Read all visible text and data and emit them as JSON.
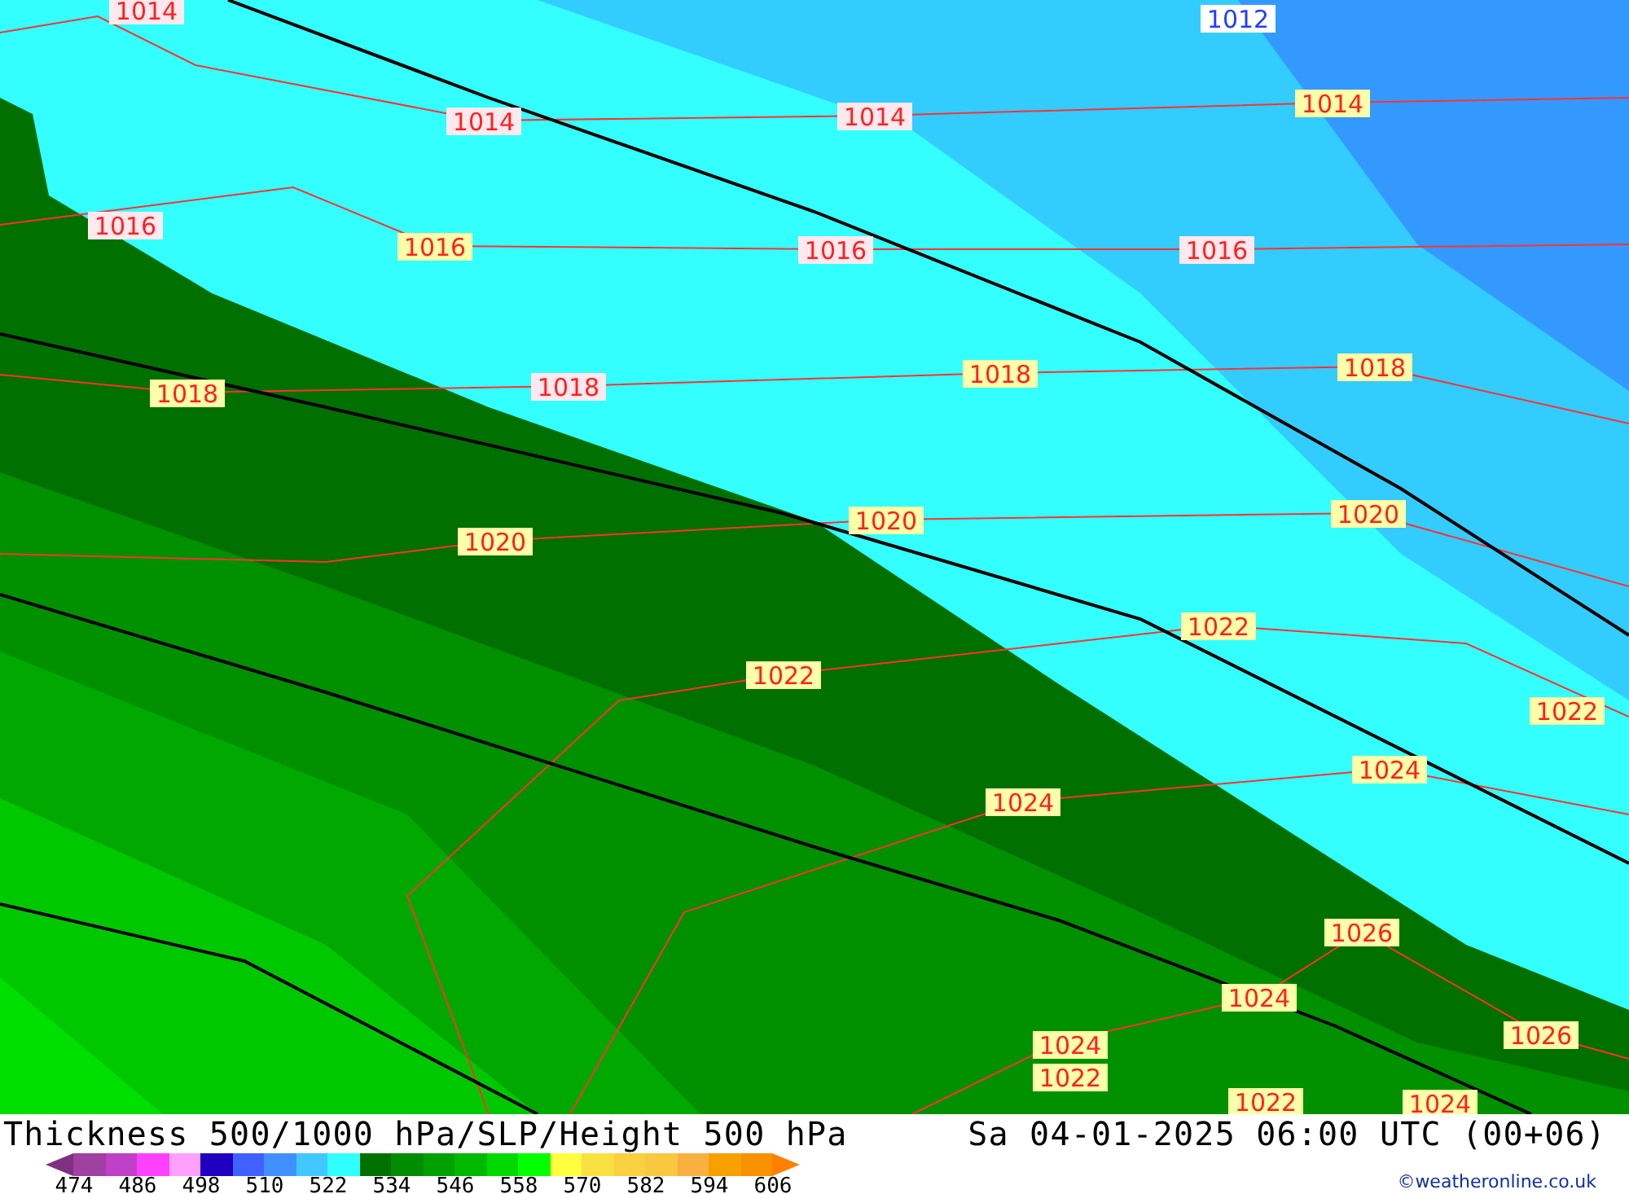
{
  "map": {
    "isobar_labels": [
      {
        "text": "1014"
      },
      {
        "text": "1012"
      },
      {
        "text": "1014"
      },
      {
        "text": "1014"
      },
      {
        "text": "1014"
      },
      {
        "text": "1016"
      },
      {
        "text": "1016"
      },
      {
        "text": "1016"
      },
      {
        "text": "1016"
      },
      {
        "text": "1018"
      },
      {
        "text": "1018"
      },
      {
        "text": "1018"
      },
      {
        "text": "1018"
      },
      {
        "text": "1020"
      },
      {
        "text": "1020"
      },
      {
        "text": "1020"
      },
      {
        "text": "1022"
      },
      {
        "text": "1022"
      },
      {
        "text": "1022"
      },
      {
        "text": "1024"
      },
      {
        "text": "1024"
      },
      {
        "text": "1026"
      },
      {
        "text": "1024"
      },
      {
        "text": "1026"
      },
      {
        "text": "1024"
      },
      {
        "text": "1022"
      },
      {
        "text": "1022"
      },
      {
        "text": "1024"
      }
    ]
  },
  "title": "Thickness 500/1000 hPa/SLP/Height 500 hPa",
  "valid_time": "Sa 04-01-2025 06:00 UTC (00+06)",
  "legend": {
    "low_end": {
      "color": "#803080"
    },
    "high_end": {
      "color": "#ff8000"
    },
    "bins": [
      {
        "color": "#a040a0"
      },
      {
        "color": "#c040c8"
      },
      {
        "color": "#ff40ff"
      },
      {
        "color": "#ffa0ff"
      },
      {
        "color": "#2000c0"
      },
      {
        "color": "#4060ff"
      },
      {
        "color": "#4090ff"
      },
      {
        "color": "#40c8ff"
      },
      {
        "color": "#30ffff"
      },
      {
        "color": "#007000"
      },
      {
        "color": "#008c00"
      },
      {
        "color": "#00a000"
      },
      {
        "color": "#00b800"
      },
      {
        "color": "#00d800"
      },
      {
        "color": "#00ff00"
      },
      {
        "color": "#ffff40"
      },
      {
        "color": "#f8e040"
      },
      {
        "color": "#f8d040"
      },
      {
        "color": "#f8c840"
      },
      {
        "color": "#f8b040"
      },
      {
        "color": "#f8a000"
      },
      {
        "color": "#f89000"
      }
    ],
    "ticks": [
      "474",
      "486",
      "498",
      "510",
      "522",
      "534",
      "546",
      "558",
      "570",
      "582",
      "594",
      "606"
    ]
  },
  "credit": "©weatheronline.co.uk"
}
